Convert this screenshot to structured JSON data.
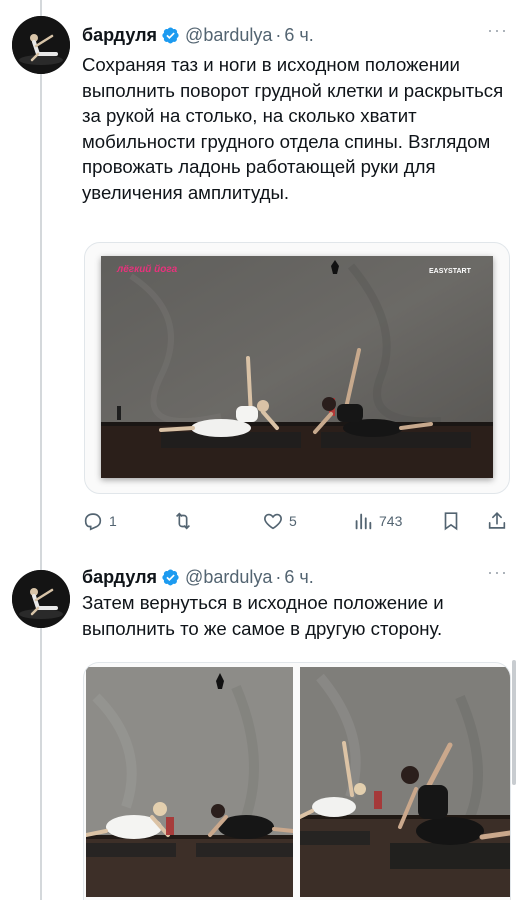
{
  "thread": [
    {
      "author": {
        "name": "бардуля",
        "handle": "@bardulya",
        "separator": "·",
        "time": "6 ч.",
        "verified": true,
        "avatar_icon": "avatar-yoga-pose"
      },
      "text": "Сохраняя таз и ноги в исходном положении выполнить поворот грудной клетки и раскрыться за рукой на столько, на сколько хватит мобильности грудного отдела спины. Взглядом провожать ладонь работающей руки для увеличения амплитуды.",
      "media": {
        "type": "video",
        "overlay_logo_left": "лёгкий йога",
        "overlay_logo_right": "EASYSTART"
      },
      "actions": {
        "reply_count": "1",
        "retweet_count": "",
        "like_count": "5",
        "views_count": "743"
      }
    },
    {
      "author": {
        "name": "бардуля",
        "handle": "@bardulya",
        "separator": "·",
        "time": "6 ч.",
        "verified": true,
        "avatar_icon": "avatar-yoga-pose"
      },
      "text": "Затем вернуться в исходное положение и выполнить то же самое в другую сторону.",
      "media": {
        "type": "photo-grid",
        "count": 2
      }
    }
  ],
  "icons": {
    "more": "more-icon",
    "reply": "reply-icon",
    "retweet": "retweet-icon",
    "like": "heart-icon",
    "views": "views-icon",
    "bookmark": "bookmark-icon",
    "share": "share-icon",
    "verified": "verified-badge-icon"
  },
  "colors": {
    "text": "#0f1419",
    "secondary": "#536471",
    "verified": "#1d9bf0",
    "border": "#e1e6ea",
    "thread_line": "#d4d8db",
    "logo_pink": "#e8327c"
  }
}
